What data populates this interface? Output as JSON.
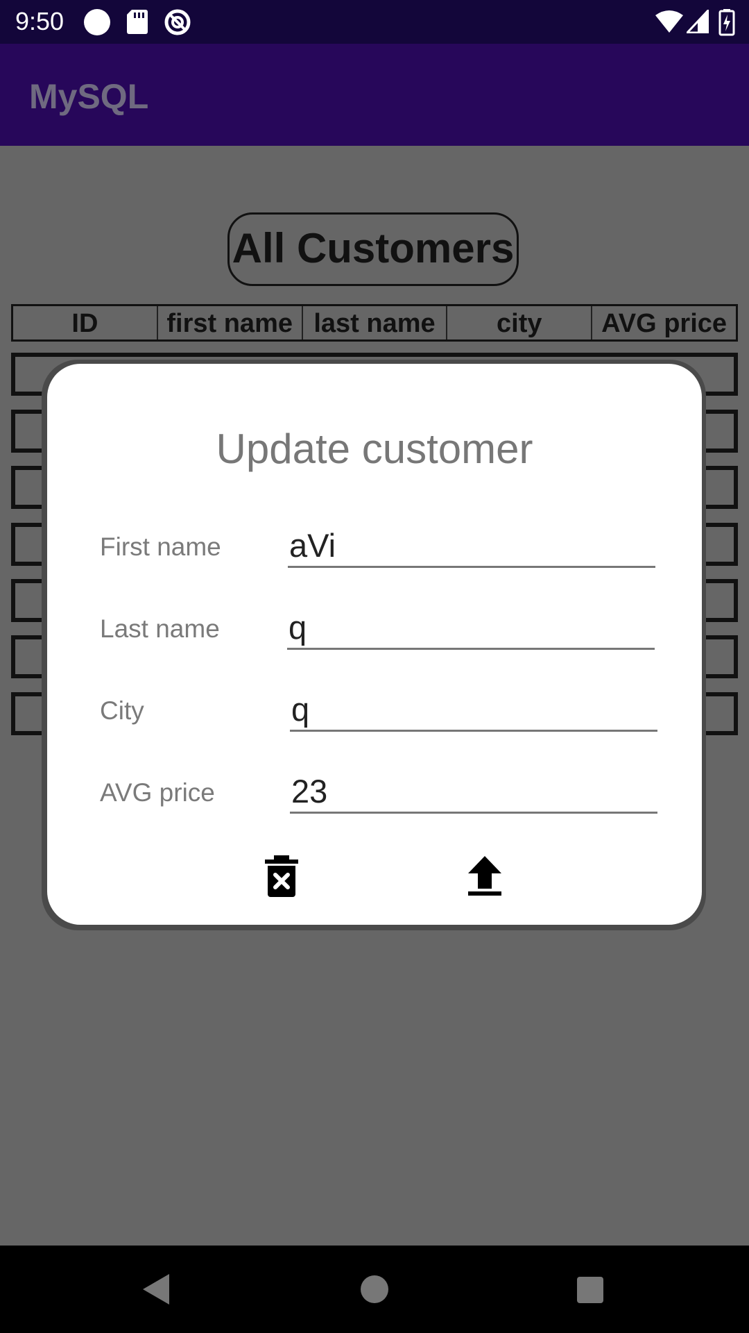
{
  "status_bar": {
    "time": "9:50",
    "icons_left": [
      "circle-icon",
      "sd-card-icon",
      "no-disturb-icon"
    ],
    "icons_right": [
      "wifi-icon",
      "signal-icon",
      "battery-charging-icon"
    ]
  },
  "app_bar": {
    "title": "MySQL"
  },
  "content": {
    "all_customers_label": "All Customers",
    "table_headers": [
      "ID",
      "first name",
      "last name",
      "city",
      "AVG price"
    ]
  },
  "dialog": {
    "title": "Update customer",
    "fields": {
      "first_name": {
        "label": "First name",
        "value": "aVi"
      },
      "last_name": {
        "label": "Last name",
        "value": "q"
      },
      "city": {
        "label": "City",
        "value": "q"
      },
      "avg_price": {
        "label": "AVG price",
        "value": "23"
      }
    },
    "actions": [
      "delete-icon",
      "upload-icon"
    ]
  },
  "nav_bar": {
    "buttons": [
      "back-icon",
      "home-icon",
      "recents-icon"
    ]
  },
  "colors": {
    "status_bar": "#13063a",
    "app_bar": "#27075a",
    "scrim_background": "#666666",
    "dialog_background": "#ffffff"
  }
}
